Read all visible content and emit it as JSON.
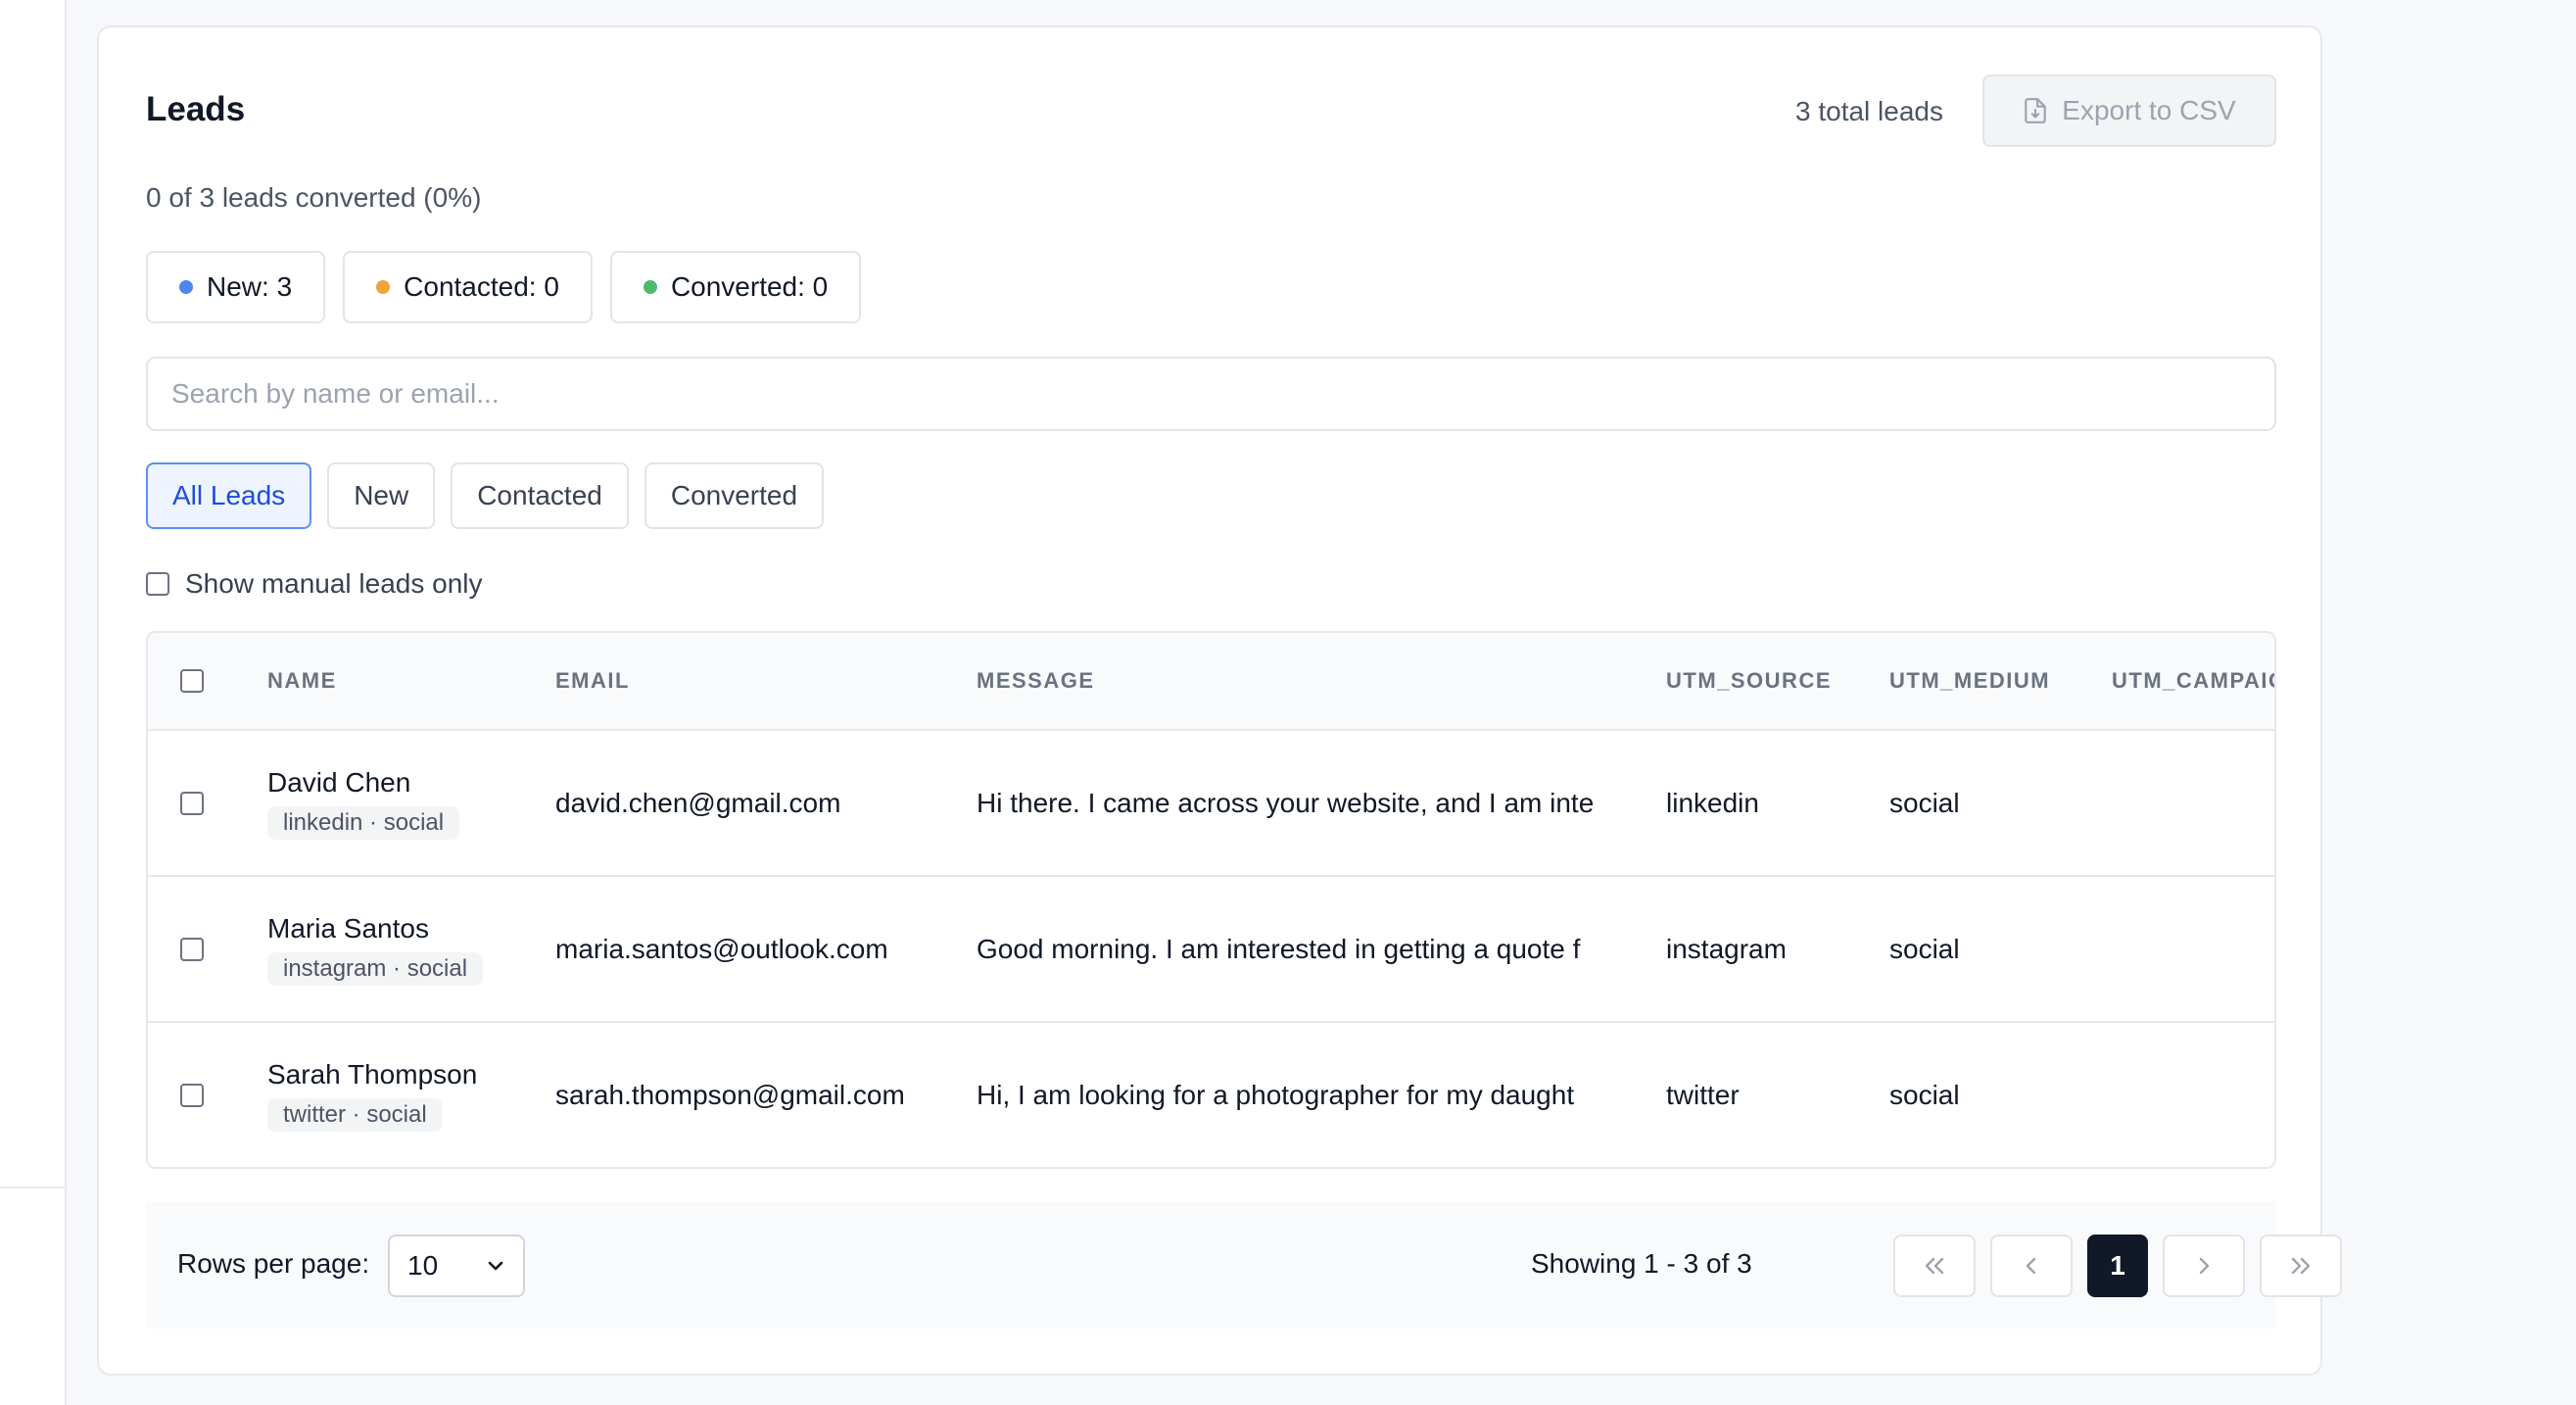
{
  "header": {
    "title": "Leads",
    "total_leads": "3 total leads",
    "export_label": "Export to CSV"
  },
  "summary": {
    "converted_text": "0 of 3 leads converted (0%)",
    "statuses": [
      {
        "label": "New: 3",
        "color": "#4f86ec"
      },
      {
        "label": "Contacted: 0",
        "color": "#f0a336"
      },
      {
        "label": "Converted: 0",
        "color": "#4cb96b"
      }
    ]
  },
  "search": {
    "placeholder": "Search by name or email..."
  },
  "filters": {
    "tabs": [
      "All Leads",
      "New",
      "Contacted",
      "Converted"
    ],
    "active": "All Leads",
    "manual_only_label": "Show manual leads only"
  },
  "table": {
    "columns": [
      "NAME",
      "EMAIL",
      "MESSAGE",
      "UTM_SOURCE",
      "UTM_MEDIUM",
      "UTM_CAMPAIG"
    ],
    "rows": [
      {
        "name": "David Chen",
        "tag": "linkedin · social",
        "email": "david.chen@gmail.com",
        "message": "Hi there. I came across your website, and I am inte",
        "utm_source": "linkedin",
        "utm_medium": "social",
        "utm_campaign": ""
      },
      {
        "name": "Maria Santos",
        "tag": "instagram · social",
        "email": "maria.santos@outlook.com",
        "message": "Good morning. I am interested in getting a quote f",
        "utm_source": "instagram",
        "utm_medium": "social",
        "utm_campaign": ""
      },
      {
        "name": "Sarah Thompson",
        "tag": "twitter · social",
        "email": "sarah.thompson@gmail.com",
        "message": "Hi, I am looking for a photographer for my daught",
        "utm_source": "twitter",
        "utm_medium": "social",
        "utm_campaign": ""
      }
    ]
  },
  "pagination": {
    "rows_per_page_label": "Rows per page:",
    "rows_per_page_value": "10",
    "showing_text": "Showing 1 - 3 of 3",
    "current_page": "1"
  }
}
